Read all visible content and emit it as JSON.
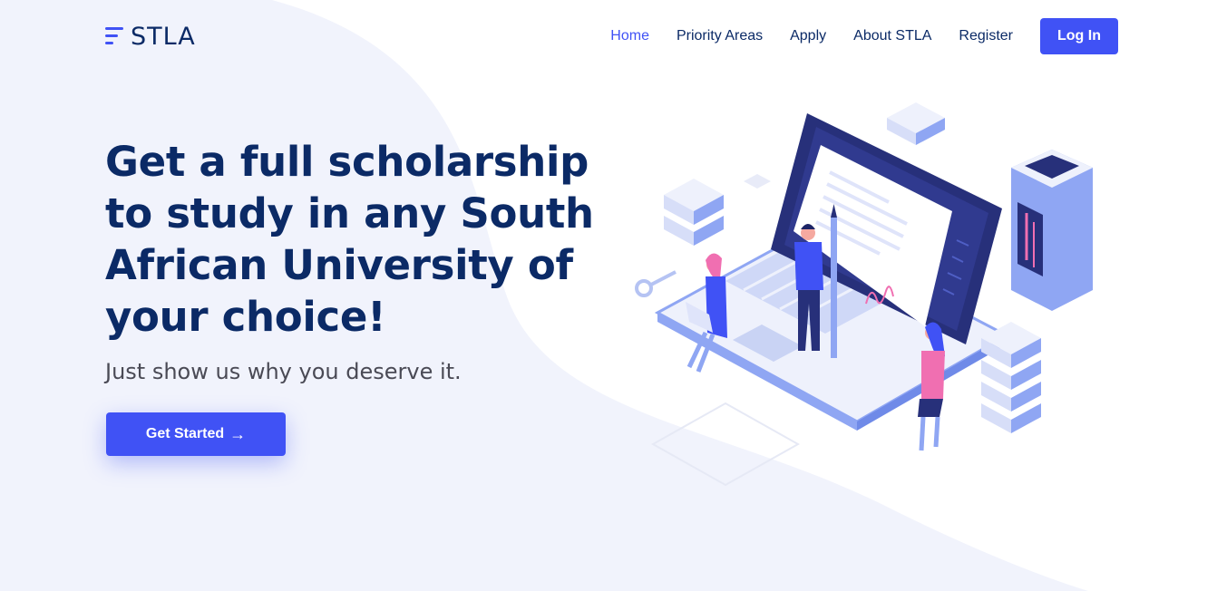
{
  "brand": {
    "name": "STLA"
  },
  "nav": {
    "items": [
      {
        "label": "Home",
        "active": true
      },
      {
        "label": "Priority Areas",
        "active": false
      },
      {
        "label": "Apply",
        "active": false
      },
      {
        "label": "About STLA",
        "active": false
      },
      {
        "label": "Register",
        "active": false
      }
    ],
    "login_label": "Log In"
  },
  "hero": {
    "title": "Get a full scholarship to study in any South African University of your choice!",
    "subtitle": "Just show us why you deserve it.",
    "cta_label": "Get Started",
    "cta_icon": "arrow-right-icon"
  },
  "colors": {
    "accent": "#4052f5",
    "heading": "#0b2a66",
    "background_wave": "#f1f3fc"
  }
}
